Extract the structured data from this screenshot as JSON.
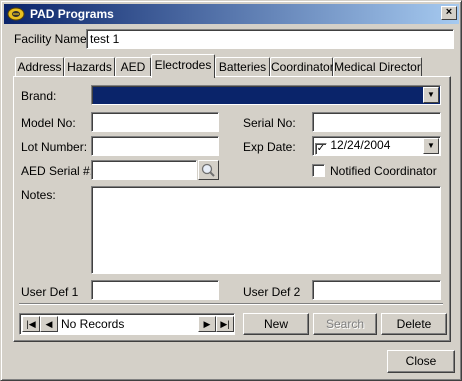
{
  "window": {
    "title": "PAD Programs",
    "close_glyph": "×",
    "icons": {
      "app": "pad-app-icon",
      "close": "close-icon"
    }
  },
  "facility": {
    "label": "Facility Name:",
    "value": "test 1"
  },
  "tabs": [
    {
      "label": "Address",
      "active": false
    },
    {
      "label": "Hazards",
      "active": false
    },
    {
      "label": "AED",
      "active": false
    },
    {
      "label": "Electrodes",
      "active": true
    },
    {
      "label": "Batteries",
      "active": false
    },
    {
      "label": "Coordinator",
      "active": false
    },
    {
      "label": "Medical Director",
      "active": false
    }
  ],
  "form": {
    "brand": {
      "label": "Brand:",
      "value": "",
      "arrow": "▼"
    },
    "model_no": {
      "label": "Model No:",
      "value": ""
    },
    "serial_no": {
      "label": "Serial No:",
      "value": ""
    },
    "lot_number": {
      "label": "Lot Number:",
      "value": ""
    },
    "exp_date": {
      "label": "Exp Date:",
      "value": "12/24/2004",
      "checked": true,
      "arrow": "▼"
    },
    "aed_serial": {
      "label": "AED Serial #:",
      "value": "",
      "icon": "magnifier-icon"
    },
    "notified_coordinator": {
      "label": "Notified Coordinator",
      "checked": false
    },
    "notes": {
      "label": "Notes:",
      "value": ""
    },
    "user_def_1": {
      "label": "User Def 1",
      "value": ""
    },
    "user_def_2": {
      "label": "User Def 2",
      "value": ""
    }
  },
  "navigator": {
    "status": "No Records",
    "first_glyph": "|◀",
    "prev_glyph": "◀",
    "next_glyph": "▶",
    "last_glyph": "▶|"
  },
  "actions": {
    "new_label": "New",
    "search_label": "Search",
    "search_enabled": false,
    "delete_label": "Delete"
  },
  "footer": {
    "close_label": "Close"
  },
  "colors": {
    "face": "#d4d0c8",
    "title_start": "#0a246a",
    "title_end": "#a6caf0",
    "selection": "#0a246a",
    "field_bg": "#ffffff"
  }
}
